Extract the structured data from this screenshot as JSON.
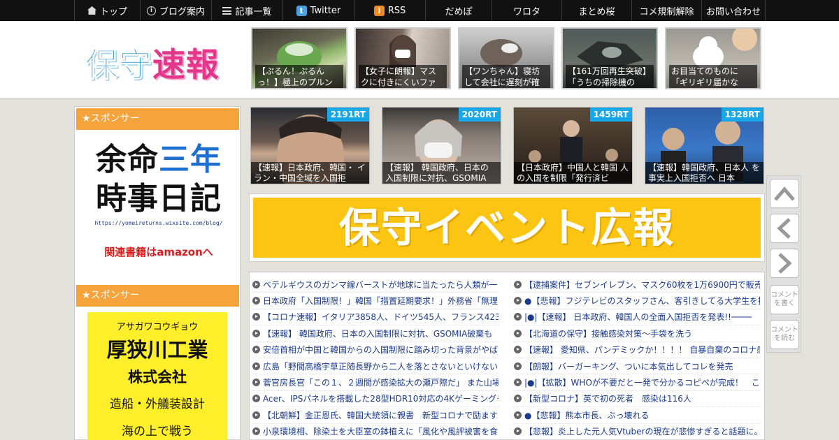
{
  "nav": {
    "items": [
      {
        "label": "トップ",
        "icon": "home-icon"
      },
      {
        "label": "ブログ案内",
        "icon": "info-icon"
      },
      {
        "label": "記事一覧",
        "icon": "list-icon"
      },
      {
        "label": "Twitter",
        "icon": "twitter-icon"
      },
      {
        "label": "RSS",
        "icon": "rss-icon"
      },
      {
        "label": "だめぽ"
      },
      {
        "label": "ワロタ"
      },
      {
        "label": "まとめ桜"
      },
      {
        "label": "コメ規制解除"
      },
      {
        "label": "お問い合わせ"
      }
    ]
  },
  "header": {
    "logo_left": "保守",
    "logo_right": "速報",
    "thumbs": [
      {
        "caption": "【ぷるん！ぷるん っ！】極上のプルン"
      },
      {
        "caption": "【女子に朗報】マス クに付きにくいファ"
      },
      {
        "caption": "【ワンちゃん】寝坊 して会社に遅刻が確"
      },
      {
        "caption": "【161万回再生突破】 「うちの掃除機の"
      },
      {
        "caption": "お目当てのものに 「ギリギリ届かな"
      }
    ]
  },
  "sidebar": {
    "sponsor_label": "★スポンサー",
    "book": {
      "line1_a": "余命",
      "line1_b": "三年",
      "line2": "時事日記",
      "url": "https://yomeireturns.wixsite.com/blog/",
      "amazon": "関連書籍はamazonへ"
    },
    "sponsor2_label": "★スポンサー",
    "ad": {
      "kana": "アサガワコウギョウ",
      "name": "厚狭川工業",
      "corp": "株式会社",
      "service": "造船・外艤装設計",
      "tagline": "海の上で戦う"
    }
  },
  "cards": [
    {
      "rt": "2191RT",
      "caption": "【速報】日本政府、韓国・ イラン・中国全域を入国拒"
    },
    {
      "rt": "2020RT",
      "caption": "【速報】 韓国政府、日本の 入国制限に対抗、GSOMIA"
    },
    {
      "rt": "1459RT",
      "caption": "【日本政府】中国人と韓国 人の入国を制限「発行済ビ"
    },
    {
      "rt": "1328RT",
      "caption": "【速報】韓国政府、日本人 を事実上入国拒否へ 日本"
    }
  ],
  "banner": {
    "text": "保守イベント広報"
  },
  "news_left": [
    "ベテルギウスのガンマ線バーストが地球に当たったら人類が一",
    "日本政府「入国制限！」韓国「措置延期要求！」外務省「無理",
    "【コロナ速報】イタリア3858人、ドイツ545人、フランス423人",
    "【速報】 韓国政府、日本の入国制限に対抗、GSOMIA破棄も",
    "安倍首相が中国と韓国からの入国制限に踏み切った背景がやば",
    "広島「野間高橋宇草正随長野から二人を落とさないといけない",
    "菅官房長官「この１、２週間が感染拡大の瀬戸際だ」 また山場",
    "Acer、IPSパネルを搭載した28型HDR10対応の4Kゲーミングモ",
    "【北朝鮮】金正恩氏、韓国大統領に親書　新型コロナで励ます",
    "小泉環境相、除染土を大臣室の鉢植えに「風化や風評被害を食"
  ],
  "news_right": [
    "【逮捕案件】セブンイレブン、マスク60枚を1万6900円で販売し",
    "●【悲報】フジテレビのスタッフさん、客引きしてる大学生を撮",
    "|●|【速報】 日本政府、韓国人の全面入国拒否を発表!!────",
    "【北海道の保守】接触感染対策～手袋を洗う",
    "【速報】 愛知県、パンデミックか！！！！ 自暴自棄のコロナ感",
    "【朗報】バーガーキング、ついに本気出してコレを発売",
    "|●|【拡散】WHOが不要だと一発で分かるコピペが完成！　これ",
    "【新型コロナ】英で初の死者　感染は116人",
    "●【悲報】熊本市長、ぶっ壊れる",
    "【悲報】炎上した元人気Vtuberの現在が悲惨すぎると話題に。"
  ],
  "side_buttons": {
    "comment_write": "コメントを書く",
    "comment_read": "コメントを読む"
  }
}
